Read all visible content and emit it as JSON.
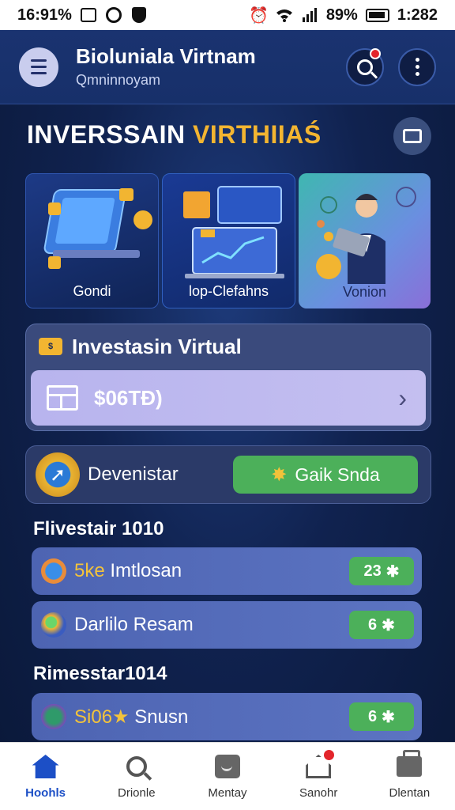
{
  "status_bar": {
    "time_left": "16:91%",
    "right_text": "89%",
    "time_right": "1:282"
  },
  "header": {
    "title": "Bioluniala Virtnam",
    "subtitle": "Qmninnoyam"
  },
  "hero": {
    "title_part1": "INVERSSAIN",
    "title_part2": "VIRTHIIAŚ"
  },
  "cards": [
    {
      "label": "Gondi"
    },
    {
      "label": "lop-Clefahns"
    },
    {
      "label": "Vonion"
    }
  ],
  "invest": {
    "title": "Investasin Virtual",
    "money_icon_text": "$",
    "field_value": "$06TÐ)"
  },
  "dev": {
    "label": "Devenistar",
    "button_label": "Gaik Snda"
  },
  "sections": [
    {
      "title": "Flivestair 1010",
      "rows": [
        {
          "label_highlight": "5ke",
          "label": "Imtlosan",
          "count": "23"
        },
        {
          "label_highlight": "",
          "label": "Darlilo Resam",
          "count": "6"
        }
      ]
    },
    {
      "title": "Rimesstar1014",
      "rows": [
        {
          "label_highlight": "Si06",
          "label": "Snusn",
          "count": "6"
        }
      ]
    }
  ],
  "bottom_nav": [
    {
      "label": "Hoohls",
      "icon": "home-icon",
      "active": true
    },
    {
      "label": "Drionle",
      "icon": "search-icon",
      "active": false
    },
    {
      "label": "Mentay",
      "icon": "chat-icon",
      "active": false
    },
    {
      "label": "Sanohr",
      "icon": "house-outline-icon",
      "active": false
    },
    {
      "label": "Dlentan",
      "icon": "bag-icon",
      "active": false
    }
  ],
  "colors": {
    "accent_gold": "#f3b531",
    "accent_green": "#4cb05a",
    "nav_active": "#1c4fc6",
    "notification_red": "#e3252b"
  }
}
